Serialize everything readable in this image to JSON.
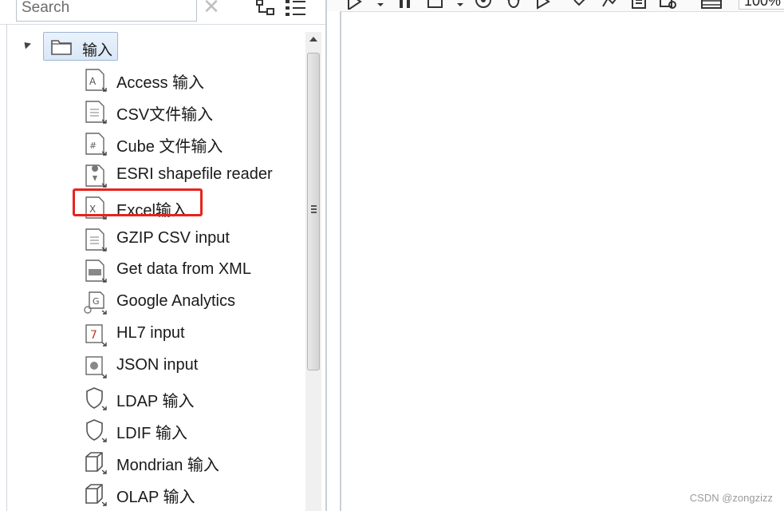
{
  "search": {
    "placeholder": "Search",
    "clear_glyph": "✕"
  },
  "tree": {
    "root": {
      "label": "输入",
      "icon": "folder-icon"
    },
    "items": [
      {
        "label": "Access 输入",
        "icon": "access-file-icon"
      },
      {
        "label": "CSV文件输入",
        "icon": "csv-file-icon"
      },
      {
        "label": "Cube 文件输入",
        "icon": "cube-file-icon"
      },
      {
        "label": "ESRI shapefile reader",
        "icon": "map-pin-file-icon"
      },
      {
        "label": "Excel输入",
        "icon": "excel-file-icon",
        "highlighted": true
      },
      {
        "label": "GZIP CSV input",
        "icon": "gzip-file-icon"
      },
      {
        "label": "Get data from XML",
        "icon": "xml-file-icon"
      },
      {
        "label": "Google Analytics",
        "icon": "google-analytics-icon"
      },
      {
        "label": "HL7 input",
        "icon": "hl7-icon"
      },
      {
        "label": "JSON input",
        "icon": "json-icon"
      },
      {
        "label": "LDAP 输入",
        "icon": "shield-icon"
      },
      {
        "label": "LDIF 输入",
        "icon": "shield-icon"
      },
      {
        "label": "Mondrian 输入",
        "icon": "cube-icon"
      },
      {
        "label": "OLAP 输入",
        "icon": "cube-icon"
      }
    ]
  },
  "toolbar": {
    "zoom": "100%"
  },
  "highlight_color": "#e8231f",
  "watermark": "CSDN @zongzizz"
}
